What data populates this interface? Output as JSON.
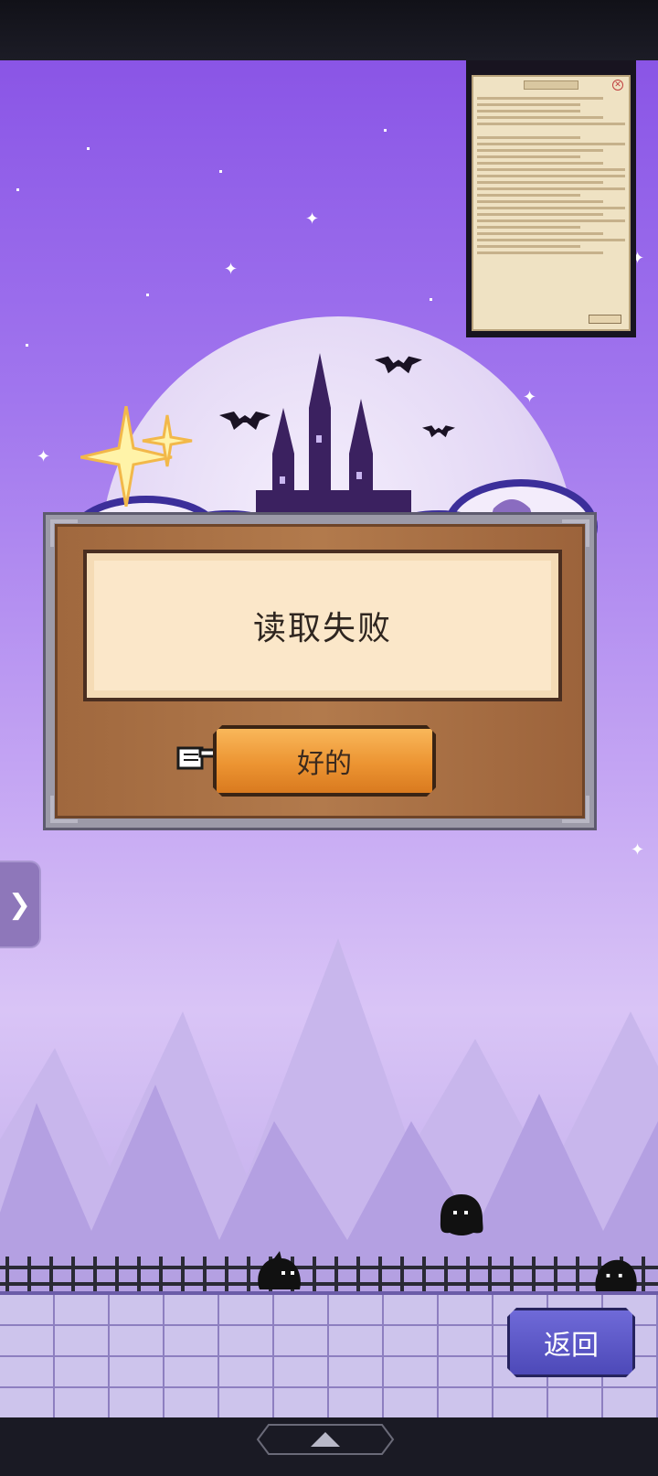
{
  "dialog": {
    "message": "读取失败",
    "ok_label": "好的"
  },
  "controls": {
    "back_label": "返回",
    "side_tab_icon": "chevron-right-icon",
    "nav_handle_icon": "chevron-up-icon"
  },
  "colors": {
    "sky_top": "#8a55e6",
    "dialog_wood": "#b27a4c",
    "message_paper": "#fbe7c9",
    "ok_button": "#ec9432",
    "back_button": "#5a56c8"
  }
}
